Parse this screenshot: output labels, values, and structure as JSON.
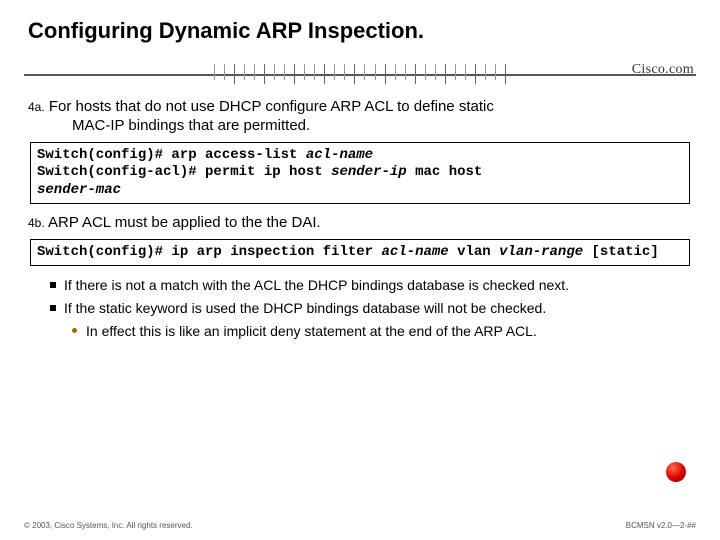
{
  "title": "Configuring Dynamic ARP Inspection.",
  "logo": {
    "name": "Cisco.com",
    "sub": ""
  },
  "step4a": {
    "num": "4a.",
    "text_line1": "For hosts that do not use DHCP configure ARP ACL to define static",
    "text_line2": "MAC-IP bindings that are permitted."
  },
  "code4a": {
    "l1_prompt": "Switch(config)# ",
    "l1_cmd": "arp access-list ",
    "l1_arg": "acl-name",
    "l2_prompt": "Switch(config-acl)# ",
    "l2_cmd1": "permit ip host ",
    "l2_arg1": "sender-ip",
    "l2_cmd2": " mac host ",
    "l3_arg": "sender-mac"
  },
  "step4b": {
    "num": "4b.",
    "text": "ARP ACL must be applied to the the DAI."
  },
  "code4b": {
    "l1_prompt": "Switch(config)# ",
    "l1_cmd": "ip arp inspection filter ",
    "l1_arg1": "acl-name",
    "l1_cmd2": " vlan ",
    "l1_arg2": "vlan-range",
    "l1_cmd3": " [static]"
  },
  "bullets": {
    "b1": "If there is not a match with the ACL the DHCP bindings database is checked next.",
    "b2": "If the static keyword is used the DHCP bindings database will not be checked.",
    "b2_1": "In effect this is like an implicit deny statement at the end of the ARP ACL."
  },
  "footer": {
    "left": "© 2003, Cisco Systems, Inc. All rights reserved.",
    "right": "BCMSN v2.0—2-##"
  }
}
